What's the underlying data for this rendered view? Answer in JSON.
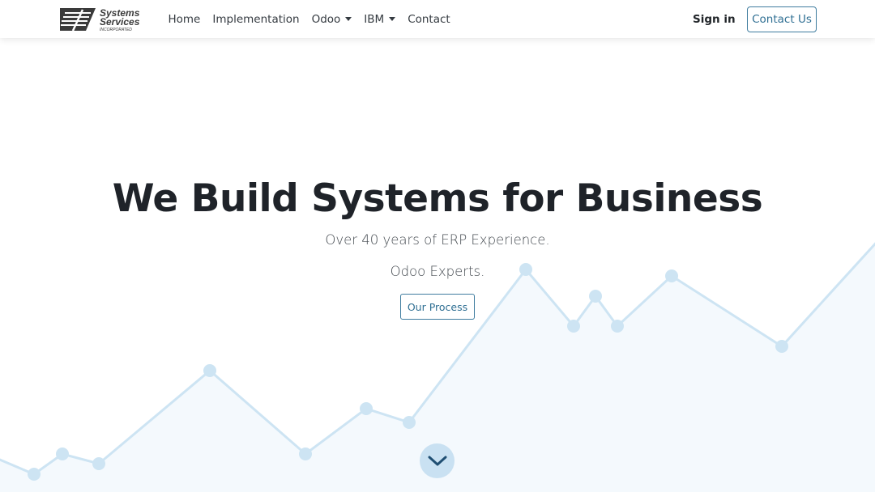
{
  "brand": {
    "logo_lines": [
      "Systems",
      "Services",
      "INCORPORATED"
    ]
  },
  "nav": {
    "items": [
      {
        "label": "Home",
        "dropdown": false
      },
      {
        "label": "Implementation",
        "dropdown": false
      },
      {
        "label": "Odoo",
        "dropdown": true
      },
      {
        "label": "IBM",
        "dropdown": true
      },
      {
        "label": "Contact",
        "dropdown": false
      }
    ],
    "signin_label": "Sign in",
    "contact_button_label": "Contact Us"
  },
  "hero": {
    "title": "We Build Systems for Business",
    "subtitle": "Over 40 years of ERP Experience.",
    "tagline": "Odoo Experts.",
    "cta_label": "Our Process",
    "scroll_icon": "chevron-down-icon"
  },
  "colors": {
    "accent": "#2f6f93",
    "chart_line": "#cde4f3",
    "chart_fill": "#f4f9fd",
    "scroll_bg": "#c9e1f2",
    "scroll_chevron": "#1f4f73"
  }
}
